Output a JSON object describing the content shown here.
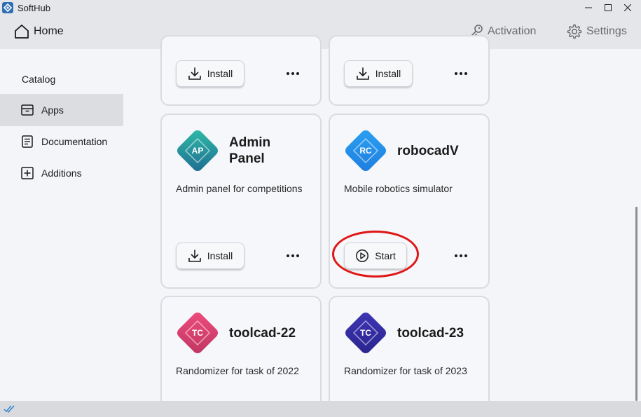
{
  "window": {
    "title": "SoftHub",
    "minimize_glyph": "—",
    "maximize_glyph": "☐",
    "close_glyph": "✕"
  },
  "header": {
    "home_label": "Home",
    "activation_label": "Activation",
    "settings_label": "Settings"
  },
  "sidebar": {
    "section_label": "Catalog",
    "items": [
      {
        "label": "Apps",
        "icon": "archive-icon",
        "active": true
      },
      {
        "label": "Documentation",
        "icon": "document-icon",
        "active": false
      },
      {
        "label": "Additions",
        "icon": "plus-square-icon",
        "active": false
      }
    ]
  },
  "cards": {
    "top_left": {
      "button_label": "Install"
    },
    "top_right": {
      "button_label": "Install"
    },
    "admin_panel": {
      "logo_text": "AP",
      "title_line1": "Admin",
      "title_line2": "Panel",
      "description": "Admin panel for competitions",
      "button_label": "Install",
      "color_top": "#2fb8a6",
      "color_bottom": "#1f6f92"
    },
    "robocadv": {
      "logo_text": "RC",
      "title": "robocadV",
      "description": "Mobile robotics simulator",
      "button_label": "Start",
      "color_top": "#2a9ff0",
      "color_bottom": "#1f7fe0"
    },
    "toolcad22": {
      "logo_text": "TC",
      "title": "toolcad-22",
      "description": "Randomizer for task of 2022",
      "color_top": "#ec4b7c",
      "color_bottom": "#c23763"
    },
    "toolcad23": {
      "logo_text": "TC",
      "title": "toolcad-23",
      "description": "Randomizer for task of 2023",
      "color_top": "#3d35b3",
      "color_bottom": "#2b2590"
    }
  },
  "colors": {
    "highlight": "#e01616",
    "accent_blue": "#2a7fd4"
  }
}
